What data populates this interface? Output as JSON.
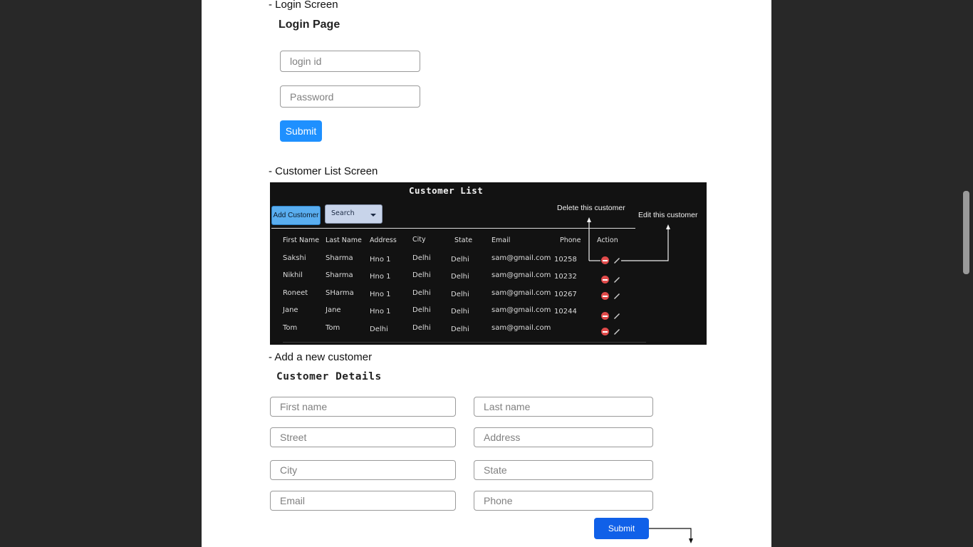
{
  "sections": {
    "login_title": "- Login Screen",
    "list_title": "- Customer List  Screen",
    "add_title": "- Add a new customer"
  },
  "login": {
    "heading": "Login Page",
    "login_placeholder": "login id",
    "password_placeholder": "Password",
    "submit_label": "Submit"
  },
  "customer_list": {
    "title": "Customer List",
    "add_button": "Add Customer",
    "search_label": "Search",
    "delete_note": "Delete this customer",
    "edit_note": "Edit this customer",
    "columns": [
      "First Name",
      "Last Name",
      "Address",
      "City",
      "State",
      "Email",
      "Phone",
      "Action"
    ],
    "rows": [
      [
        "Sakshi",
        "Sharma",
        "Hno 1",
        "Delhi",
        "Delhi",
        "sam@gmail.com",
        "10258"
      ],
      [
        "Nikhil",
        "Sharma",
        "Hno 1",
        "Delhi",
        "Delhi",
        "sam@gmail.com",
        "10232"
      ],
      [
        "Roneet",
        "SHarma",
        "Hno 1",
        "Delhi",
        "Delhi",
        "sam@gmail.com",
        "10267"
      ],
      [
        "Jane",
        "Jane",
        "Hno 1",
        "Delhi",
        "Delhi",
        "sam@gmail.com",
        "10244"
      ],
      [
        "Tom",
        "Tom",
        "Delhi",
        "Delhi",
        "Delhi",
        "sam@gmail.com",
        ""
      ]
    ],
    "action_icons": [
      "delete-icon",
      "edit-icon"
    ],
    "colors": {
      "background": "#121212",
      "add_button": "#5aaef0",
      "delete": "#e04a4a"
    }
  },
  "customer_details": {
    "heading": "Customer Details",
    "first_name_placeholder": "First name",
    "last_name_placeholder": "Last name",
    "street_placeholder": "Street",
    "address_placeholder": "Address",
    "city_placeholder": "City",
    "state_placeholder": "State",
    "email_placeholder": "Email",
    "phone_placeholder": "Phone",
    "submit_label": "Submit"
  },
  "colors": {
    "primary": "#1e90ff",
    "viewer_bg": "#282828",
    "page_bg": "#ffffff"
  }
}
